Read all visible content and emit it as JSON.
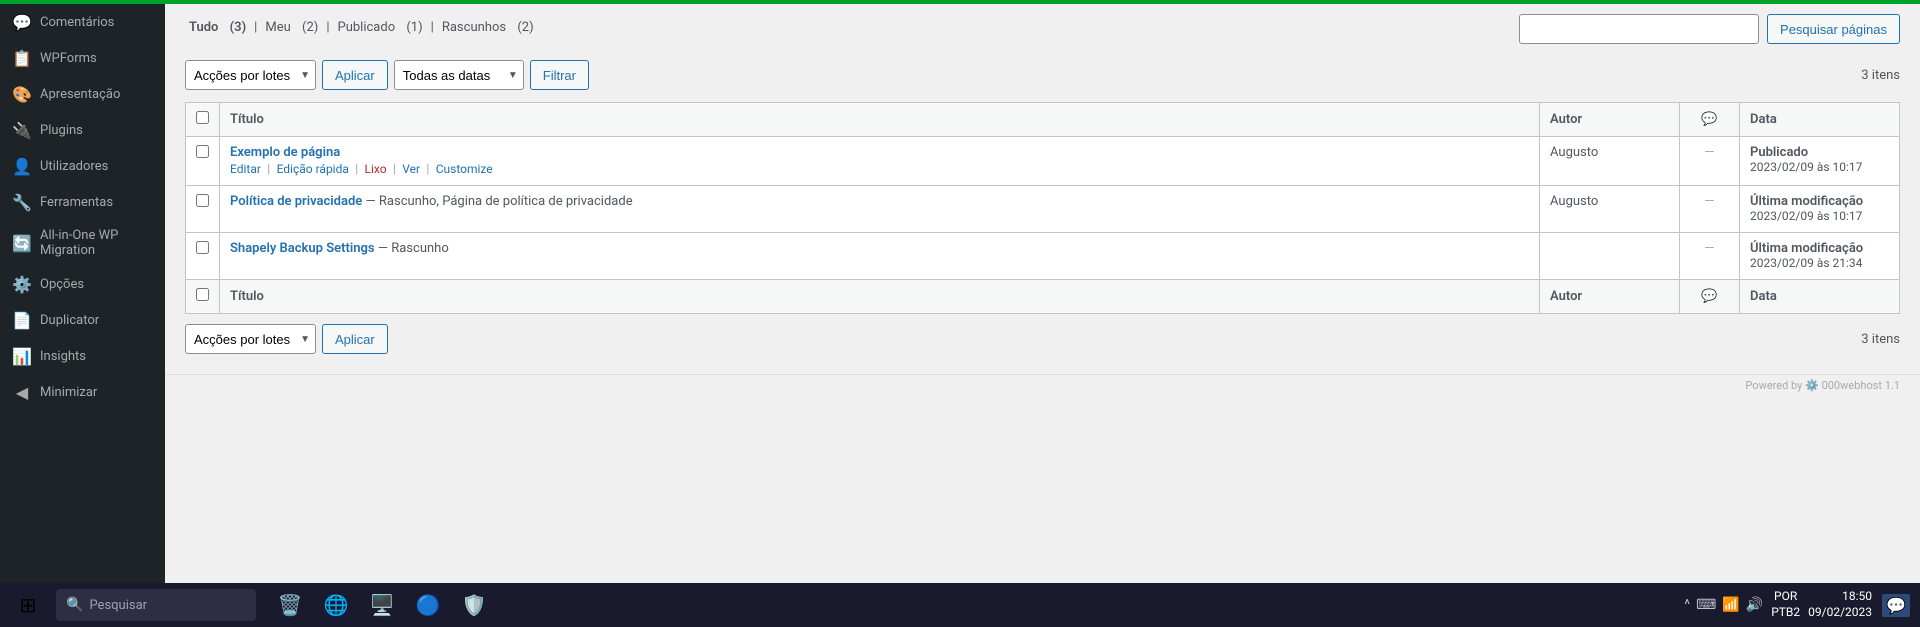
{
  "sidebar": {
    "items": [
      {
        "id": "comentarios",
        "label": "Comentários",
        "icon": "💬"
      },
      {
        "id": "wpforms",
        "label": "WPForms",
        "icon": "📋"
      },
      {
        "id": "apresentacao",
        "label": "Apresentação",
        "icon": "🎨"
      },
      {
        "id": "plugins",
        "label": "Plugins",
        "icon": "🔌"
      },
      {
        "id": "utilizadores",
        "label": "Utilizadores",
        "icon": "👤"
      },
      {
        "id": "ferramentas",
        "label": "Ferramentas",
        "icon": "🔧"
      },
      {
        "id": "allinone",
        "label": "All-in-One WP Migration",
        "icon": "🔄"
      },
      {
        "id": "opcoes",
        "label": "Opções",
        "icon": "⚙️"
      },
      {
        "id": "duplicator",
        "label": "Duplicator",
        "icon": "📄"
      },
      {
        "id": "insights",
        "label": "Insights",
        "icon": "📊"
      },
      {
        "id": "minimizar",
        "label": "Minimizar",
        "icon": "◀"
      }
    ]
  },
  "filter_links": {
    "tudo": "Tudo",
    "tudo_count": "(3)",
    "meu": "Meu",
    "meu_count": "(2)",
    "publicado": "Publicado",
    "publicado_count": "(1)",
    "rascunhos": "Rascunhos",
    "rascunhos_count": "(2)",
    "separator": "|"
  },
  "search": {
    "placeholder": "",
    "button": "Pesquisar páginas"
  },
  "filters": {
    "bulk_action_label": "Acções por lotes",
    "apply_label": "Aplicar",
    "date_filter_label": "Todas as datas",
    "filter_label": "Filtrar"
  },
  "table": {
    "headers": {
      "title": "Título",
      "author": "Autor",
      "comments_icon": "💬",
      "date": "Data"
    },
    "rows": [
      {
        "id": 1,
        "title": "Exemplo de página",
        "actions": [
          {
            "label": "Editar",
            "type": "edit"
          },
          {
            "label": "Edição rápida",
            "type": "quick-edit"
          },
          {
            "label": "Lixo",
            "type": "trash"
          },
          {
            "label": "Ver",
            "type": "view"
          },
          {
            "label": "Customize",
            "type": "customize"
          }
        ],
        "author": "Augusto",
        "comments": "—",
        "date_status": "Publicado",
        "date_value": "2023/02/09 às 10:17"
      },
      {
        "id": 2,
        "title": "Política de privacidade",
        "title_suffix": "— Rascunho, Página de política de privacidade",
        "actions": [],
        "author": "Augusto",
        "comments": "—",
        "date_status": "Última modificação",
        "date_value": "2023/02/09 às 10:17"
      },
      {
        "id": 3,
        "title": "Shapely Backup Settings",
        "title_suffix": "— Rascunho",
        "actions": [],
        "author": "",
        "comments": "—",
        "date_status": "Última modificação",
        "date_value": "2023/02/09 às 21:34"
      }
    ],
    "footer_headers": {
      "title": "Título",
      "author": "Autor",
      "comments_icon": "💬",
      "date": "Data"
    }
  },
  "counts": {
    "top": "3 itens",
    "bottom": "3 itens"
  },
  "powered_bar": {
    "text": "Powered by",
    "host": "000webhost",
    "version": "1.1"
  },
  "taskbar": {
    "search_placeholder": "Pesquisar",
    "apps": [
      {
        "id": "recycle",
        "icon": "🗑️",
        "color": "#4a90d9"
      },
      {
        "id": "edge",
        "icon": "🌐",
        "color": "#0078d4"
      },
      {
        "id": "xampp",
        "icon": "🖥️",
        "color": "#fb7c00"
      },
      {
        "id": "chrome",
        "icon": "🔵",
        "color": "#4285f4"
      },
      {
        "id": "file",
        "icon": "🛡️",
        "color": "#2563eb"
      }
    ],
    "lang": "POR\nPTB2",
    "time": "18:50",
    "date": "09/02/2023",
    "notification_icon": "💬"
  },
  "green_bar_visible": true
}
